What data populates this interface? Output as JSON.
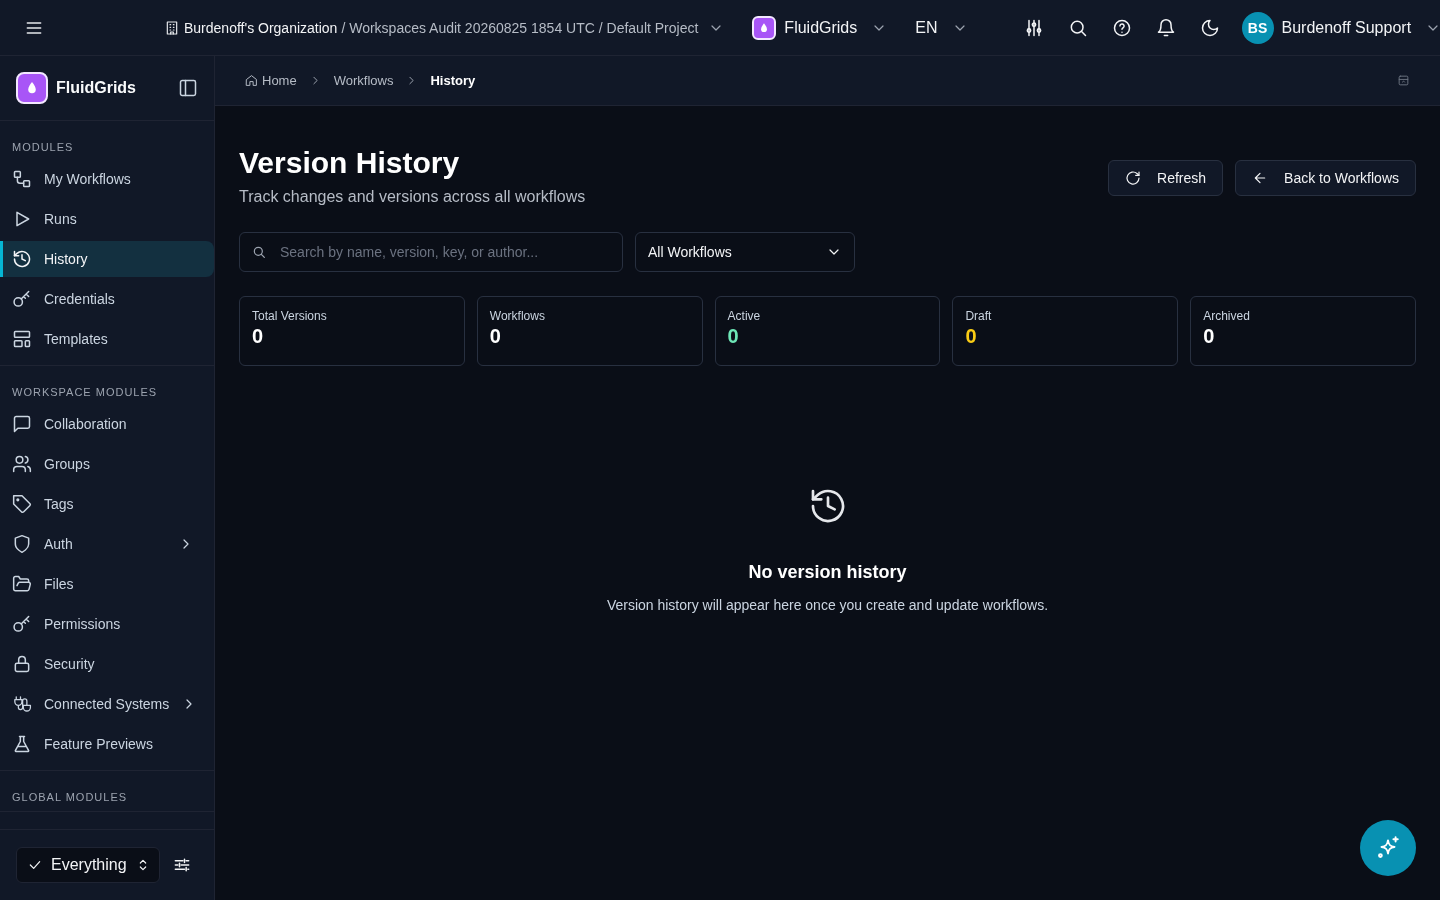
{
  "topbar": {
    "organization": "Burdenoff's Organization",
    "path": "/ Workspaces Audit 20260825 1854 UTC / Default Project",
    "app": "FluidGrids",
    "language": "EN",
    "user": {
      "initials": "BS",
      "name": "Burdenoff Support"
    }
  },
  "sidebar": {
    "brand": "FluidGrids",
    "sections": [
      {
        "title": "MODULES",
        "items": [
          {
            "kind": "workflow",
            "label": "My Workflows",
            "selected": false,
            "expandable": false
          },
          {
            "kind": "play",
            "label": "Runs",
            "selected": false,
            "expandable": false
          },
          {
            "kind": "history",
            "label": "History",
            "selected": true,
            "expandable": false
          },
          {
            "kind": "key",
            "label": "Credentials",
            "selected": false,
            "expandable": false
          },
          {
            "kind": "template",
            "label": "Templates",
            "selected": false,
            "expandable": false
          }
        ]
      },
      {
        "title": "WORKSPACE MODULES",
        "items": [
          {
            "kind": "chat",
            "label": "Collaboration",
            "selected": false,
            "expandable": false
          },
          {
            "kind": "users",
            "label": "Groups",
            "selected": false,
            "expandable": false
          },
          {
            "kind": "tag",
            "label": "Tags",
            "selected": false,
            "expandable": false
          },
          {
            "kind": "shield",
            "label": "Auth",
            "selected": false,
            "expandable": true
          },
          {
            "kind": "folder",
            "label": "Files",
            "selected": false,
            "expandable": false
          },
          {
            "kind": "key",
            "label": "Permissions",
            "selected": false,
            "expandable": false
          },
          {
            "kind": "lock",
            "label": "Security",
            "selected": false,
            "expandable": false
          },
          {
            "kind": "plug",
            "label": "Connected Systems",
            "selected": false,
            "expandable": true
          },
          {
            "kind": "flask",
            "label": "Feature Previews",
            "selected": false,
            "expandable": false
          }
        ]
      },
      {
        "title": "GLOBAL MODULES"
      }
    ],
    "scope": "Everything"
  },
  "breadcrumb": [
    {
      "label": "Home",
      "current": false
    },
    {
      "label": "Workflows",
      "current": false
    },
    {
      "label": "History",
      "current": true
    }
  ],
  "page": {
    "title": "Version History",
    "subtitle": "Track changes and versions across all workflows",
    "buttons": [
      {
        "kind": "refresh",
        "label": "Refresh"
      },
      {
        "kind": "back",
        "label": "Back to Workflows"
      }
    ],
    "search": {
      "placeholder": "Search by name, version, key, or author..."
    },
    "filter": "All Workflows",
    "stats": [
      {
        "label": "Total Versions",
        "value": "0",
        "color": "#ffffff"
      },
      {
        "label": "Workflows",
        "value": "0",
        "color": "#ffffff"
      },
      {
        "label": "Active",
        "value": "0",
        "color": "#6ee7b7"
      },
      {
        "label": "Draft",
        "value": "0",
        "color": "#facc15"
      },
      {
        "label": "Archived",
        "value": "0",
        "color": "#ffffff"
      }
    ],
    "empty": {
      "title": "No version history",
      "message": "Version history will appear here once you create and update workflows."
    }
  }
}
